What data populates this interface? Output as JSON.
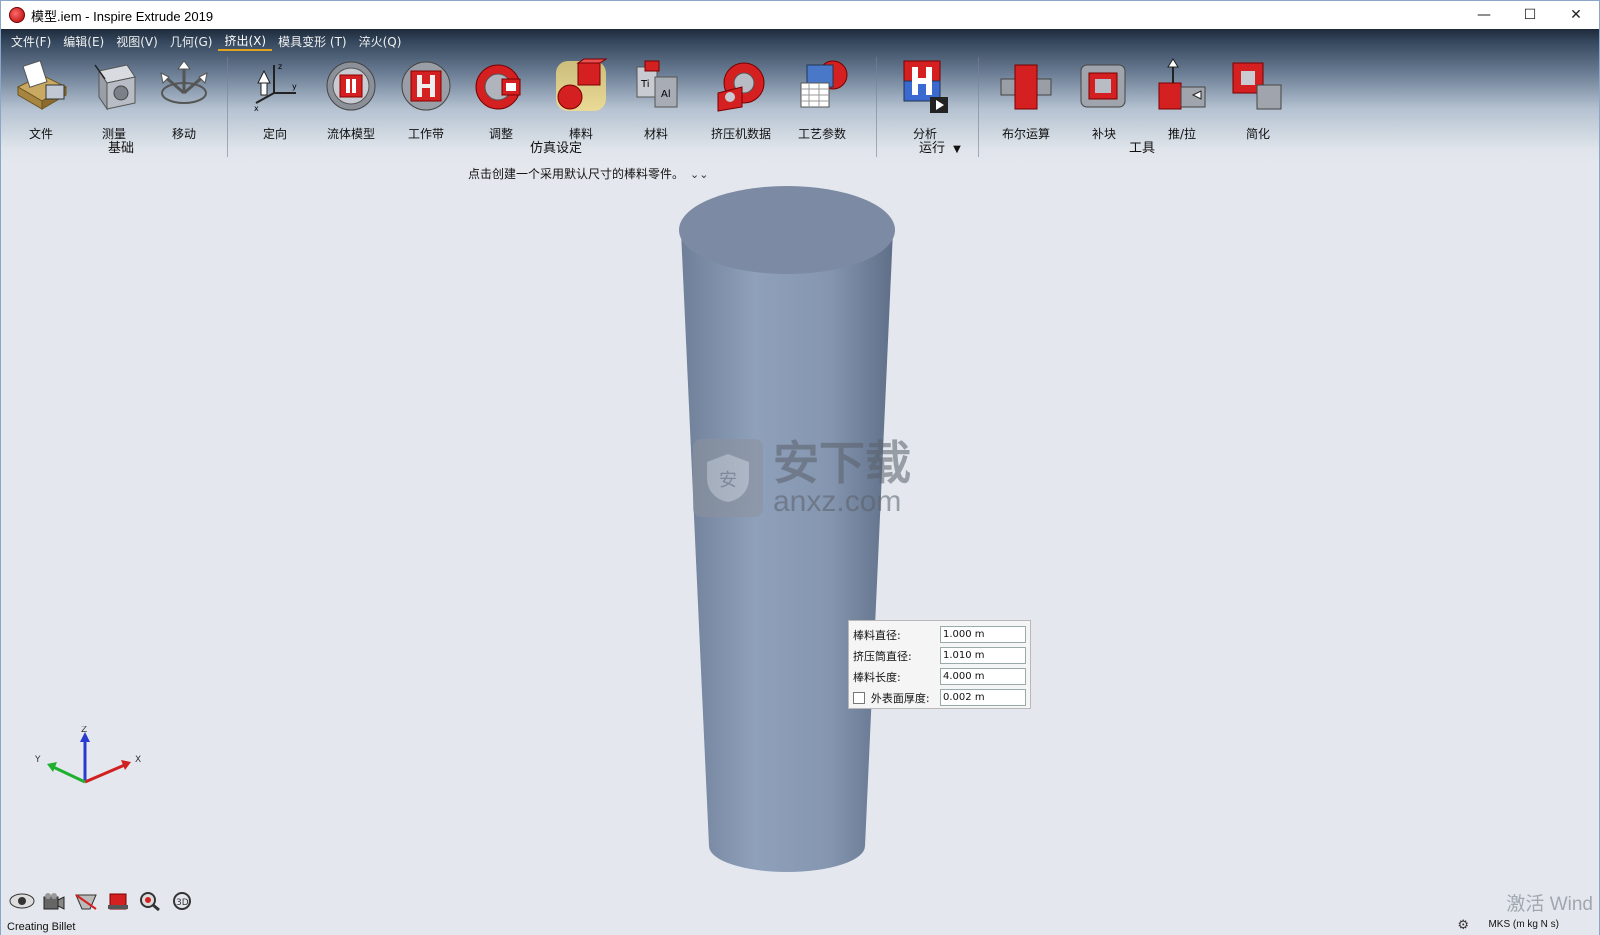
{
  "window": {
    "title": "模型.iem - Inspire Extrude 2019",
    "controls": {
      "minimize": "—",
      "maximize": "☐",
      "close": "✕"
    }
  },
  "menu": [
    {
      "label": "文件(F)",
      "active": false
    },
    {
      "label": "编辑(E)",
      "active": false
    },
    {
      "label": "视图(V)",
      "active": false
    },
    {
      "label": "几何(G)",
      "active": false
    },
    {
      "label": "挤出(X)",
      "active": true
    },
    {
      "label": "模具变形 (T)",
      "active": false
    },
    {
      "label": "淬火(Q)",
      "active": false
    }
  ],
  "toolbar": {
    "tools": [
      {
        "label": "文件",
        "icon": "file-icon"
      },
      {
        "label": "测量",
        "icon": "measure-icon"
      },
      {
        "label": "移动",
        "icon": "move-icon"
      },
      {
        "label": "定向",
        "icon": "orient-icon"
      },
      {
        "label": "流体模型",
        "icon": "fluid-model-icon"
      },
      {
        "label": "工作带",
        "icon": "bearing-icon"
      },
      {
        "label": "调整",
        "icon": "adjust-icon"
      },
      {
        "label": "棒料",
        "icon": "billet-icon"
      },
      {
        "label": "材料",
        "icon": "material-icon"
      },
      {
        "label": "挤压机数据",
        "icon": "press-data-icon"
      },
      {
        "label": "工艺参数",
        "icon": "process-params-icon"
      },
      {
        "label": "分析",
        "icon": "analyze-icon"
      },
      {
        "label": "布尔运算",
        "icon": "boolean-icon"
      },
      {
        "label": "补块",
        "icon": "patch-icon"
      },
      {
        "label": "推/拉",
        "icon": "push-pull-icon"
      },
      {
        "label": "简化",
        "icon": "simplify-icon"
      }
    ],
    "groups": {
      "basic": "基础",
      "sim_setup": "仿真设定",
      "run": "运行",
      "tools": "工具"
    },
    "hint": "点击创建一个采用默认尺寸的棒料零件。"
  },
  "billet_panel": {
    "billet_diameter_label": "棒料直径:",
    "billet_diameter_value": "1.000 m",
    "container_diameter_label": "挤压筒直径:",
    "container_diameter_value": "1.010 m",
    "billet_length_label": "棒料长度:",
    "billet_length_value": "4.000 m",
    "skin_thickness_label": "外表面厚度:",
    "skin_thickness_value": "0.002 m",
    "skin_thickness_checked": false
  },
  "triad": {
    "x": "X",
    "y": "Y",
    "z": "Z"
  },
  "watermark": {
    "big": "安下载",
    "small": "anxz.com"
  },
  "status": {
    "text": "Creating Billet",
    "units": "MKS (m kg N s)",
    "activation": "激活 Wind"
  },
  "colors": {
    "accent_red": "#d42020",
    "cylinder": "#8b9bb6",
    "background": "#e4e8ee"
  }
}
